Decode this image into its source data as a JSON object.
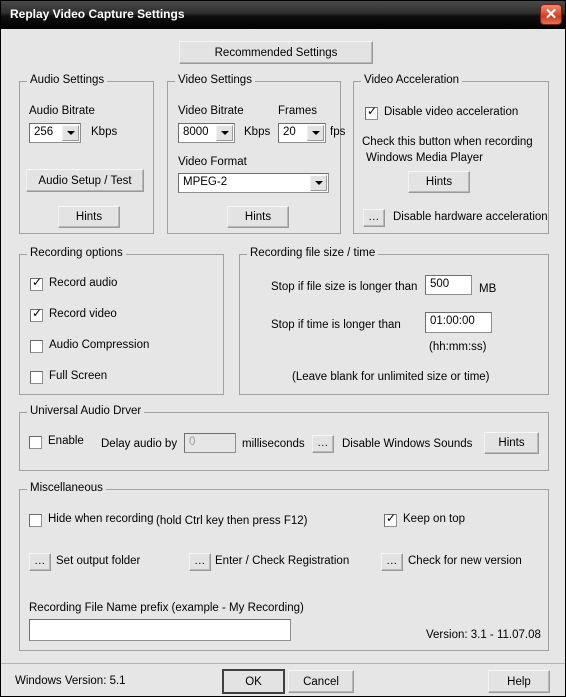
{
  "window": {
    "title": "Replay Video Capture Settings",
    "close_icon": "close-icon",
    "close_glyph": "✕"
  },
  "recommended_button": "Recommended Settings",
  "audio_settings": {
    "group_label": "Audio Settings",
    "bitrate_label": "Audio Bitrate",
    "bitrate_value": "256",
    "bitrate_unit": "Kbps",
    "setup_test_button": "Audio Setup / Test",
    "hints_button": "Hints"
  },
  "video_settings": {
    "group_label": "Video Settings",
    "bitrate_label": "Video Bitrate",
    "bitrate_value": "8000",
    "bitrate_unit": "Kbps",
    "frames_label": "Frames",
    "frames_value": "20",
    "frames_unit": "fps",
    "format_label": "Video Format",
    "format_value": "MPEG-2",
    "hints_button": "Hints"
  },
  "video_acceleration": {
    "group_label": "Video Acceleration",
    "disable_accel_label": "Disable video acceleration",
    "disable_accel_checked": true,
    "help_line1": "Check this button when recording",
    "help_line2": "Windows Media Player",
    "hints_button": "Hints",
    "dots_button": "...",
    "disable_hardware_label": "Disable hardware acceleration"
  },
  "recording_options": {
    "group_label": "Recording options",
    "items": [
      {
        "label": "Record audio",
        "checked": true
      },
      {
        "label": "Record video",
        "checked": true
      },
      {
        "label": "Audio Compression",
        "checked": false
      },
      {
        "label": "Full Screen",
        "checked": false
      }
    ]
  },
  "recording_filesize": {
    "group_label": "Recording file size / time",
    "filesize_label": "Stop if file size is longer than",
    "filesize_value": "500",
    "filesize_unit": "MB",
    "time_label": "Stop if time is longer than",
    "time_value": "01:00:00",
    "time_format_hint": "(hh:mm:ss)",
    "blank_hint": "(Leave blank for unlimited size or time)"
  },
  "universal_audio_driver": {
    "group_label": "Universal Audio Drver",
    "enable_label": "Enable",
    "enable_checked": false,
    "delay_label": "Delay audio by",
    "delay_value": "0",
    "delay_unit": "milliseconds",
    "dots_button": "...",
    "disable_sounds_label": "Disable Windows Sounds",
    "hints_button": "Hints"
  },
  "miscellaneous": {
    "group_label": "Miscellaneous",
    "hide_when_recording_label": "Hide when recording",
    "hide_when_recording_checked": false,
    "hotkey_hint": "(hold Ctrl key then press F12)",
    "keep_on_top_label": "Keep on top",
    "keep_on_top_checked": true,
    "dots_button": "...",
    "set_output_folder_label": "Set output folder",
    "registration_label": "Enter / Check Registration",
    "check_version_label": "Check for new version",
    "prefix_label": "Recording File Name prefix (example -  My Recording)",
    "prefix_value": "",
    "version_text": "Version: 3.1 - 11.07.08"
  },
  "footer": {
    "windows_version": "Windows Version: 5.1",
    "ok_button": "OK",
    "cancel_button": "Cancel",
    "help_button": "Help"
  }
}
